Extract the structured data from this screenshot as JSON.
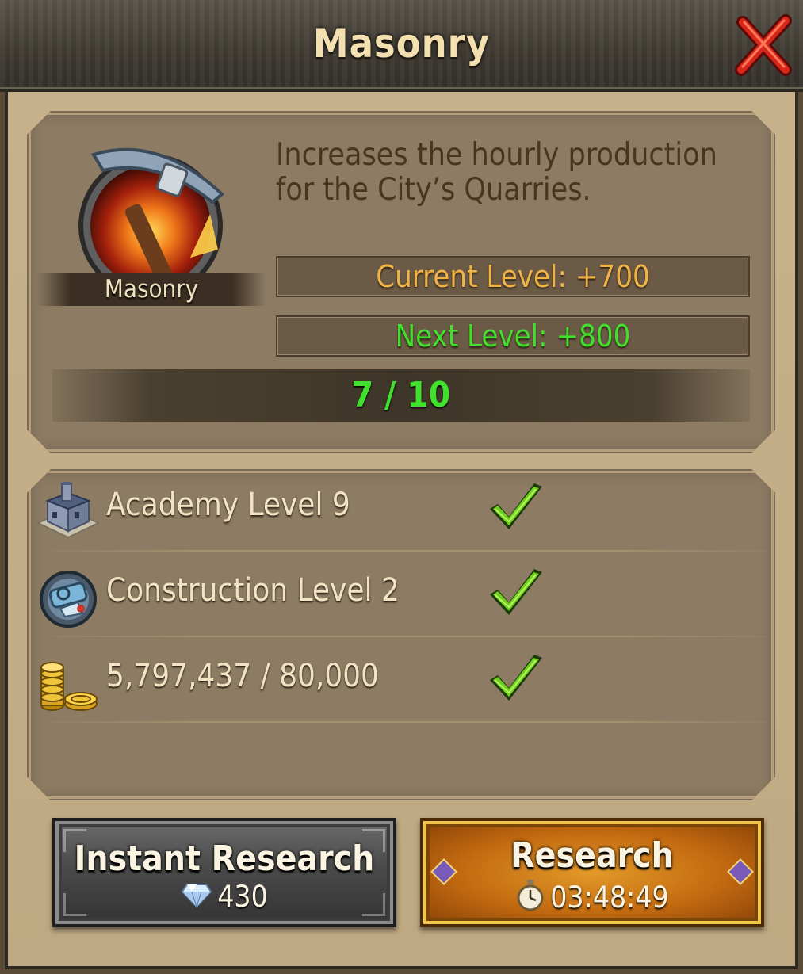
{
  "dialog": {
    "title": "Masonry",
    "close_icon": "close-x-icon"
  },
  "skill": {
    "name": "Masonry",
    "icon": "pickaxe-fire-icon",
    "description": "Increases the hourly production for the City’s Quarries.",
    "current_level_text": "Current Level: +700",
    "next_level_text": "Next Level: +800",
    "progress_text": "7 / 10",
    "progress": {
      "current": 7,
      "max": 10
    }
  },
  "requirements": [
    {
      "icon": "academy-building-icon",
      "text": "Academy Level 9",
      "met": true
    },
    {
      "icon": "construction-research-icon",
      "text": "Construction Level 2",
      "met": true
    },
    {
      "icon": "gold-coins-icon",
      "text": "5,797,437 / 80,000",
      "met": true
    }
  ],
  "buttons": {
    "instant": {
      "label": "Instant Research",
      "cost": "430",
      "cost_icon": "diamond-icon"
    },
    "research": {
      "label": "Research",
      "time": "03:48:49",
      "time_icon": "stopwatch-icon"
    }
  },
  "colors": {
    "current_level": "#f0b347",
    "next_level": "#40e02c",
    "progress_text": "#3fe12c",
    "description": "#4a3520"
  }
}
